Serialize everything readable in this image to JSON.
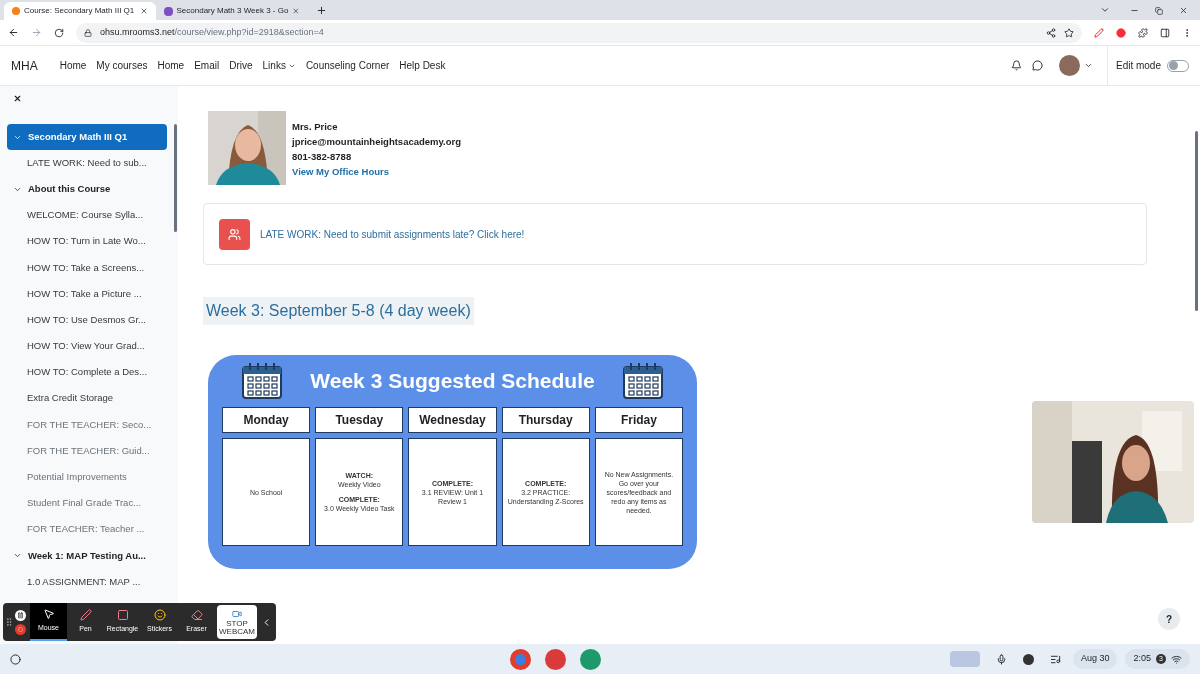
{
  "browser": {
    "tabs": [
      {
        "title": "Course: Secondary Math III Q1",
        "selected": true,
        "kind": "moodle"
      },
      {
        "title": "Secondary Math 3 Week 3 - Go",
        "selected": false,
        "kind": "slides"
      }
    ],
    "url_host": "ohsu.mrooms3.net",
    "url_path": "/course/view.php?id=2918&section=4"
  },
  "navbar": {
    "brand": "MHA",
    "links": [
      {
        "label": "Home",
        "dropdown": false
      },
      {
        "label": "My courses",
        "dropdown": false
      },
      {
        "label": "Home",
        "dropdown": false
      },
      {
        "label": "Email",
        "dropdown": false
      },
      {
        "label": "Drive",
        "dropdown": false
      },
      {
        "label": "Links",
        "dropdown": true
      },
      {
        "label": "Counseling Corner",
        "dropdown": false
      },
      {
        "label": "Help Desk",
        "dropdown": false
      }
    ],
    "edit_mode": {
      "label": "Edit mode",
      "on": false
    }
  },
  "sidebar": {
    "sections": [
      {
        "label": "Secondary Math III Q1",
        "expanded": true,
        "selected": true,
        "children": [
          {
            "label": "LATE WORK: Need to sub...",
            "dimmed": false
          }
        ]
      },
      {
        "label": "About this Course",
        "expanded": true,
        "selected": false,
        "children": [
          {
            "label": "WELCOME: Course Sylla...",
            "dimmed": false
          },
          {
            "label": "HOW TO: Turn in Late Wo...",
            "dimmed": false
          },
          {
            "label": "HOW TO: Take a Screens...",
            "dimmed": false
          },
          {
            "label": "HOW TO: Take a Picture ...",
            "dimmed": false
          },
          {
            "label": "HOW TO: Use Desmos Gr...",
            "dimmed": false
          },
          {
            "label": "HOW TO: View Your Grad...",
            "dimmed": false
          },
          {
            "label": "HOW TO: Complete a Des...",
            "dimmed": false
          },
          {
            "label": "Extra Credit Storage",
            "dimmed": false
          },
          {
            "label": "FOR THE TEACHER: Seco...",
            "dimmed": true
          },
          {
            "label": "FOR THE TEACHER: Guid...",
            "dimmed": true
          },
          {
            "label": "Potential Improvements",
            "dimmed": true
          },
          {
            "label": "Student Final Grade Trac...",
            "dimmed": true
          },
          {
            "label": "FOR TEACHER: Teacher ...",
            "dimmed": true
          }
        ]
      },
      {
        "label": "Week 1: MAP Testing Au...",
        "expanded": true,
        "selected": false,
        "children": [
          {
            "label": "1.0 ASSIGNMENT: MAP ...",
            "dimmed": false
          }
        ]
      }
    ]
  },
  "teacher": {
    "name": "Mrs. Price",
    "email": "jprice@mountainheightsacademy.org",
    "phone": "801-382-8788",
    "link": "View My Office Hours"
  },
  "late_work": {
    "text": "LATE WORK: Need to submit assignments late? Click here!"
  },
  "section_title": "Week 3: September 5-8 (4 day week)",
  "schedule": {
    "title": "Week 3 Suggested Schedule",
    "days": [
      {
        "day": "Monday",
        "blocks": [
          {
            "text": "No School"
          }
        ]
      },
      {
        "day": "Tuesday",
        "blocks": [
          {
            "label": "WATCH:",
            "text": "Weekly Video"
          },
          {
            "label": "COMPLETE:",
            "text": "3.0 Weekly Video Task"
          }
        ]
      },
      {
        "day": "Wednesday",
        "blocks": [
          {
            "label": "COMPLETE:",
            "text": "3.1 REVIEW: Unit 1 Review 1"
          }
        ]
      },
      {
        "day": "Thursday",
        "blocks": [
          {
            "label": "COMPLETE:",
            "text": "3.2 PRACTICE: Understanding Z-Scores"
          }
        ]
      },
      {
        "day": "Friday",
        "blocks": [
          {
            "text": "No New Assignments. Go over your scores/feedback and redo any items as needed."
          }
        ]
      }
    ]
  },
  "annotation_toolbar": {
    "tools": [
      {
        "label": "Mouse",
        "selected": true,
        "kind": "mouse"
      },
      {
        "label": "Pen",
        "selected": false,
        "kind": "pen"
      },
      {
        "label": "Rectangle",
        "selected": false,
        "kind": "rectangle"
      },
      {
        "label": "Stickers",
        "selected": false,
        "kind": "stickers"
      },
      {
        "label": "Eraser",
        "selected": false,
        "kind": "eraser"
      }
    ],
    "webcam_button": "STOP WEBCAM"
  },
  "help": "?",
  "taskbar": {
    "date": "Aug 30",
    "time": "2:05",
    "badge": "3"
  }
}
